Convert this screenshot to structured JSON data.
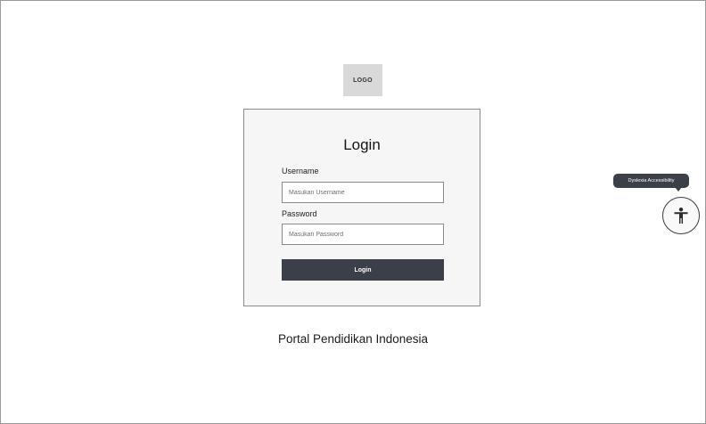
{
  "logo": {
    "text": "LOGO"
  },
  "login_card": {
    "title": "Login",
    "username": {
      "label": "Username",
      "placeholder": "Masukan Username",
      "value": ""
    },
    "password": {
      "label": "Password",
      "placeholder": "Masukan Password",
      "value": ""
    },
    "submit_label": "Login"
  },
  "footer": {
    "portal_title": "Portal Pendidikan Indonesia"
  },
  "accessibility": {
    "tooltip": "Dyslexia Accessibility",
    "icon": "accessibility-person-icon"
  },
  "colors": {
    "button_dark": "#3b3f47",
    "card_background": "#f6f6f6",
    "logo_background": "#d9d9d9",
    "border": "#8c8c8c"
  }
}
